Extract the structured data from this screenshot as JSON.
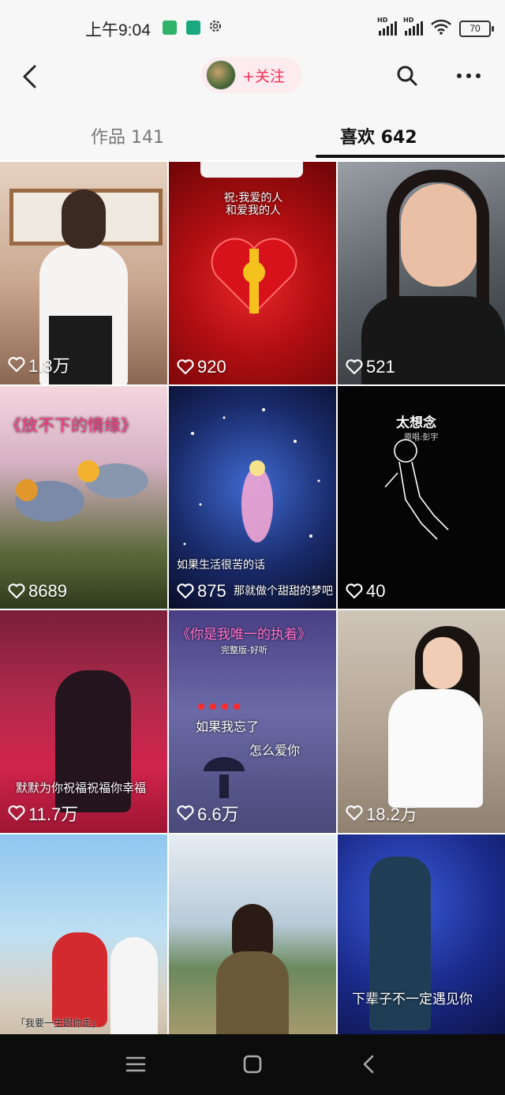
{
  "status_bar": {
    "time": "上午9:04",
    "signal1_label": "HD",
    "signal2_label": "HD",
    "battery": "70"
  },
  "header": {
    "follow_label": "+关注"
  },
  "tabs": {
    "works": "作品 141",
    "likes": "喜欢 642"
  },
  "videos": [
    {
      "likes": "1.8万"
    },
    {
      "likes": "920",
      "text": "祝:我爱的人 和爱我的人"
    },
    {
      "likes": "521"
    },
    {
      "likes": "8689",
      "text": "《放不下的情缘》"
    },
    {
      "likes": "875",
      "text": "如果生活很苦的话",
      "text2": "那就做个甜甜的梦吧"
    },
    {
      "likes": "40",
      "text": "太想念",
      "text2": "原唱:彭宇"
    },
    {
      "likes": "11.7万",
      "text": "默默为你祝福祝福你幸福"
    },
    {
      "likes": "6.6万",
      "text": "《你是我唯一的执着》",
      "text2": "完整版-好听",
      "text3": "如果我忘了",
      "text4": "怎么爱你"
    },
    {
      "likes": "18.2万"
    },
    {
      "likes": "",
      "text": "「我要一生跟你走」"
    },
    {
      "likes": ""
    },
    {
      "likes": "",
      "text": "下辈子不一定遇见你"
    }
  ]
}
